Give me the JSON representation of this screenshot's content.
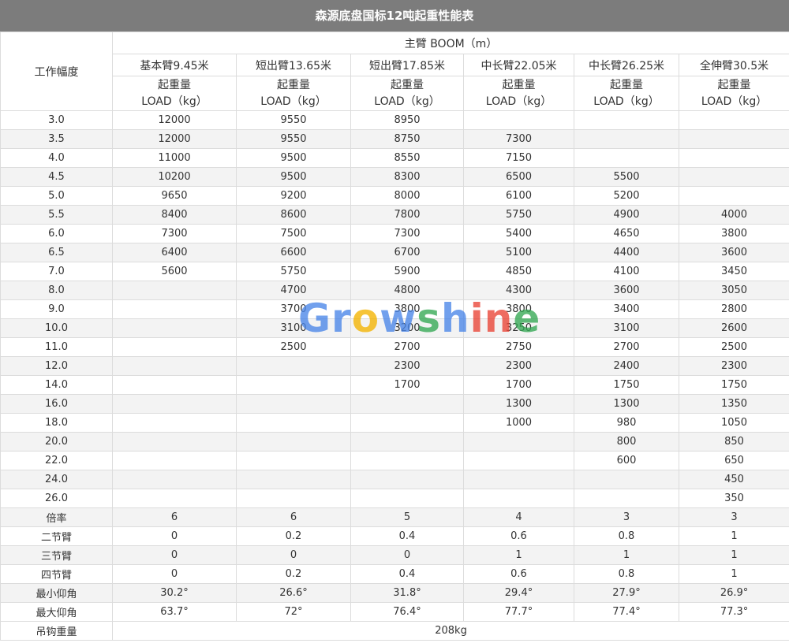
{
  "title": "森源底盘国标12吨起重性能表",
  "radius_header": "工作幅度",
  "boom_header": "主臂 BOOM（m）",
  "columns": [
    "基本臂9.45米",
    "短出臂13.65米",
    "短出臂17.85米",
    "中长臂22.05米",
    "中长臂26.25米",
    "全伸臂30.5米"
  ],
  "load_label_line1": "起重量",
  "load_label_line2": "LOAD（kg）",
  "rows": [
    {
      "radius": "3.0",
      "values": [
        "12000",
        "9550",
        "8950",
        "",
        "",
        ""
      ]
    },
    {
      "radius": "3.5",
      "values": [
        "12000",
        "9550",
        "8750",
        "7300",
        "",
        ""
      ]
    },
    {
      "radius": "4.0",
      "values": [
        "11000",
        "9500",
        "8550",
        "7150",
        "",
        ""
      ]
    },
    {
      "radius": "4.5",
      "values": [
        "10200",
        "9500",
        "8300",
        "6500",
        "5500",
        ""
      ]
    },
    {
      "radius": "5.0",
      "values": [
        "9650",
        "9200",
        "8000",
        "6100",
        "5200",
        ""
      ]
    },
    {
      "radius": "5.5",
      "values": [
        "8400",
        "8600",
        "7800",
        "5750",
        "4900",
        "4000"
      ]
    },
    {
      "radius": "6.0",
      "values": [
        "7300",
        "7500",
        "7300",
        "5400",
        "4650",
        "3800"
      ]
    },
    {
      "radius": "6.5",
      "values": [
        "6400",
        "6600",
        "6700",
        "5100",
        "4400",
        "3600"
      ]
    },
    {
      "radius": "7.0",
      "values": [
        "5600",
        "5750",
        "5900",
        "4850",
        "4100",
        "3450"
      ]
    },
    {
      "radius": "8.0",
      "values": [
        "",
        "4700",
        "4800",
        "4300",
        "3600",
        "3050"
      ]
    },
    {
      "radius": "9.0",
      "values": [
        "",
        "3700",
        "3800",
        "3800",
        "3400",
        "2800"
      ]
    },
    {
      "radius": "10.0",
      "values": [
        "",
        "3100",
        "3200",
        "3250",
        "3100",
        "2600"
      ]
    },
    {
      "radius": "11.0",
      "values": [
        "",
        "2500",
        "2700",
        "2750",
        "2700",
        "2500"
      ]
    },
    {
      "radius": "12.0",
      "values": [
        "",
        "",
        "2300",
        "2300",
        "2400",
        "2300"
      ]
    },
    {
      "radius": "14.0",
      "values": [
        "",
        "",
        "1700",
        "1700",
        "1750",
        "1750"
      ]
    },
    {
      "radius": "16.0",
      "values": [
        "",
        "",
        "",
        "1300",
        "1300",
        "1350"
      ]
    },
    {
      "radius": "18.0",
      "values": [
        "",
        "",
        "",
        "1000",
        "980",
        "1050"
      ]
    },
    {
      "radius": "20.0",
      "values": [
        "",
        "",
        "",
        "",
        "800",
        "850"
      ]
    },
    {
      "radius": "22.0",
      "values": [
        "",
        "",
        "",
        "",
        "600",
        "650"
      ]
    },
    {
      "radius": "24.0",
      "values": [
        "",
        "",
        "",
        "",
        "",
        "450"
      ]
    },
    {
      "radius": "26.0",
      "values": [
        "",
        "",
        "",
        "",
        "",
        "350"
      ]
    }
  ],
  "footer_rows": [
    {
      "label": "倍率",
      "values": [
        "6",
        "6",
        "5",
        "4",
        "3",
        "3"
      ]
    },
    {
      "label": "二节臂",
      "values": [
        "0",
        "0.2",
        "0.4",
        "0.6",
        "0.8",
        "1"
      ]
    },
    {
      "label": "三节臂",
      "values": [
        "0",
        "0",
        "0",
        "1",
        "1",
        "1"
      ]
    },
    {
      "label": "四节臂",
      "values": [
        "0",
        "0.2",
        "0.4",
        "0.6",
        "0.8",
        "1"
      ]
    },
    {
      "label": "最小仰角",
      "values": [
        "30.2°",
        "26.6°",
        "31.8°",
        "29.4°",
        "27.9°",
        "26.9°"
      ]
    },
    {
      "label": "最大仰角",
      "values": [
        "63.7°",
        "72°",
        "76.4°",
        "77.7°",
        "77.4°",
        "77.3°"
      ]
    }
  ],
  "hook_weight_label": "吊钩重量",
  "hook_weight_value": "208kg",
  "watermark": {
    "letters": [
      "G",
      "r",
      "o",
      "w",
      "s",
      "h",
      "i",
      "n",
      "e"
    ],
    "colors": [
      "#4a86e8",
      "#4a86e8",
      "#f4b400",
      "#4a86e8",
      "#34a853",
      "#4a86e8",
      "#ea4335",
      "#ea4335",
      "#34a853"
    ]
  }
}
